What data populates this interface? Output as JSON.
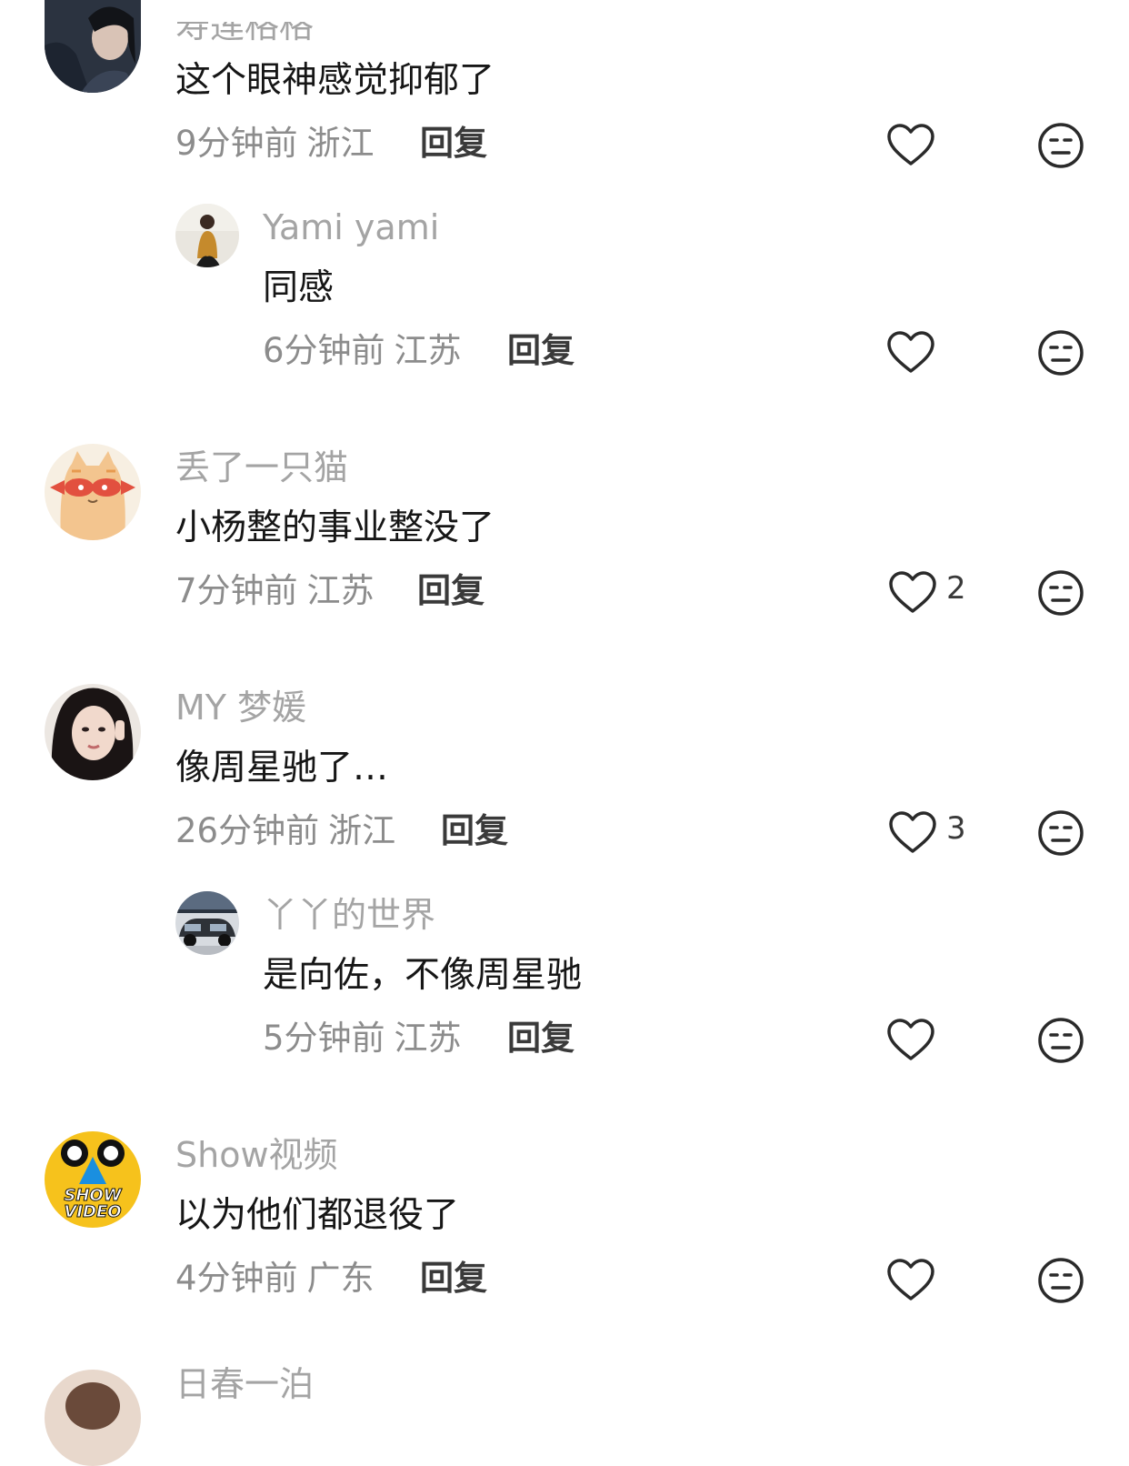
{
  "colors": {
    "name": "#a4a4a4",
    "text": "#161616",
    "meta": "#8c8c8c",
    "icon": "#2a2a2a"
  },
  "icons": {
    "like": "heart-outline-icon",
    "dislike": "neutral-face-icon"
  },
  "comments": [
    {
      "name": "寿莲格格",
      "text": "这个眼神感觉抑郁了",
      "time": "9分钟前",
      "location": "浙江",
      "reply_label": "回复",
      "likes": ""
    },
    {
      "name": "Yami yami",
      "text": "同感",
      "time": "6分钟前",
      "location": "江苏",
      "reply_label": "回复",
      "likes": ""
    },
    {
      "name": "丢了一只猫",
      "text": "小杨整的事业整没了",
      "time": "7分钟前",
      "location": "江苏",
      "reply_label": "回复",
      "likes": "2"
    },
    {
      "name": "MY 梦媛",
      "text": "像周星驰了…",
      "time": "26分钟前",
      "location": "浙江",
      "reply_label": "回复",
      "likes": "3"
    },
    {
      "name": "丫丫的世界",
      "text": "是向佐，不像周星驰",
      "time": "5分钟前",
      "location": "江苏",
      "reply_label": "回复",
      "likes": ""
    },
    {
      "name": "Show视频",
      "text": "以为他们都退役了",
      "time": "4分钟前",
      "location": "广东",
      "reply_label": "回复",
      "likes": ""
    },
    {
      "name": "日春一泊",
      "text": "",
      "time": "",
      "location": "",
      "reply_label": "",
      "likes": ""
    }
  ],
  "avatar_badges": {
    "show_video_line1": "SHOW",
    "show_video_line2": "VIDEO"
  }
}
